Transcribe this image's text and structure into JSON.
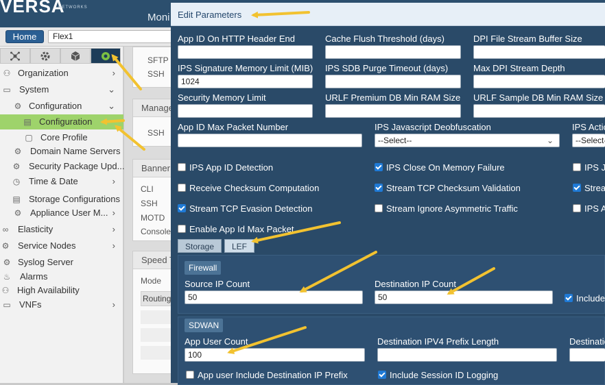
{
  "app": {
    "logo": "VERSA",
    "logo_sub": "NETWORKS",
    "title_fragment": "Moni",
    "home_label": "Home",
    "appliance_value": "Flex1"
  },
  "sidebar": {
    "tabs": [
      {
        "icon": "network-icon"
      },
      {
        "icon": "gear-icon"
      },
      {
        "icon": "cube-icon"
      },
      {
        "icon": "globe-gear-icon"
      }
    ],
    "items": [
      {
        "label": "Organization",
        "icon": "org-icon"
      },
      {
        "label": "System",
        "icon": "monitor-icon"
      },
      {
        "label": "Configuration",
        "icon": "gear-icon"
      },
      {
        "label": "Configuration",
        "icon": "doc-icon"
      },
      {
        "label": "Core Profile",
        "icon": "doc-icon"
      },
      {
        "label": "Domain Name Servers",
        "icon": "dns-icon"
      },
      {
        "label": "Security Package Upd...",
        "icon": "package-icon"
      },
      {
        "label": "Time & Date",
        "icon": "clock-icon"
      },
      {
        "label": "Storage Configurations",
        "icon": "storage-icon"
      },
      {
        "label": "Appliance User M...",
        "icon": "user-icon"
      },
      {
        "label": "Elasticity",
        "icon": "elastic-icon"
      },
      {
        "label": "Service Nodes",
        "icon": "nodes-icon"
      },
      {
        "label": "Syslog Server",
        "icon": "syslog-icon"
      },
      {
        "label": "Alarms",
        "icon": "alarm-icon"
      },
      {
        "label": "High Availability",
        "icon": "ha-icon"
      },
      {
        "label": "VNFs",
        "icon": "vnf-icon"
      }
    ]
  },
  "content": {
    "panel1_lines": [
      "SFTP",
      "SSH"
    ],
    "panel2_header": "Manage",
    "panel2_lines": [
      "SSH"
    ],
    "panel3_header": "Banner",
    "panel3_lines": [
      "CLI",
      "SSH",
      "MOTD",
      "Console"
    ],
    "panel4_header": "Speed T",
    "panel4_lines": [
      "Mode",
      "Routing"
    ]
  },
  "modal": {
    "title": "Edit Parameters",
    "fields_row1": [
      {
        "label": "App ID On HTTP Header End",
        "value": ""
      },
      {
        "label": "Cache Flush Threshold (days)",
        "value": ""
      },
      {
        "label": "DPI File Stream Buffer Size",
        "value": ""
      }
    ],
    "fields_row2": [
      {
        "label": "IPS Signature Memory Limit (MIB)",
        "value": "1024"
      },
      {
        "label": "IPS SDB Purge Timeout (days)",
        "value": ""
      },
      {
        "label": "Max DPI Stream Depth",
        "value": ""
      }
    ],
    "fields_row3": [
      {
        "label": "Security Memory Limit",
        "value": ""
      },
      {
        "label": "URLF Premium DB Min RAM Size",
        "value": ""
      },
      {
        "label": "URLF Sample DB Min RAM Size",
        "value": ""
      }
    ],
    "fields_row4": [
      {
        "label": "App ID Max Packet Number",
        "value": ""
      },
      {
        "label": "IPS Javascript Deobfuscation",
        "value": "--Select--"
      },
      {
        "label": "IPS Actio",
        "value": "--Select-"
      }
    ],
    "checkboxes": [
      {
        "label": "IPS App ID Detection",
        "checked": false
      },
      {
        "label": "IPS Close On Memory Failure",
        "checked": true
      },
      {
        "label": "IPS Ja",
        "checked": false
      },
      {
        "label": "Receive Checksum Computation",
        "checked": false
      },
      {
        "label": "Stream TCP Checksum Validation",
        "checked": true
      },
      {
        "label": "Strea",
        "checked": true
      },
      {
        "label": "Stream TCP Evasion Detection",
        "checked": true
      },
      {
        "label": "Stream Ignore Asymmetric Traffic",
        "checked": false
      },
      {
        "label": "IPS As",
        "checked": false
      },
      {
        "label": "Enable App Id Max Packet",
        "checked": false
      }
    ],
    "tabs": [
      {
        "label": "Storage",
        "active": false
      },
      {
        "label": "LEF",
        "active": true
      }
    ],
    "firewall": {
      "header": "Firewall",
      "source_label": "Source IP Count",
      "source_value": "50",
      "dest_label": "Destination IP Count",
      "dest_value": "50",
      "include_label": "Include",
      "include_checked": true
    },
    "sdwan": {
      "header": "SDWAN",
      "app_user_label": "App User Count",
      "app_user_value": "100",
      "dest_prefix_label": "Destination IPV4 Prefix Length",
      "dest_prefix_value": "",
      "destinatio_label": "Destinatio",
      "destinatio_value": "",
      "app_user_include_label": "App user Include Destination IP Prefix",
      "app_user_include_checked": false,
      "session_id_label": "Include Session ID Logging",
      "session_id_checked": true
    }
  },
  "colors": {
    "modal_bg": "#2a4a68",
    "arrow": "#f2c230",
    "selected_item": "#9ed36b",
    "header_bar": "#2c4f6e"
  }
}
